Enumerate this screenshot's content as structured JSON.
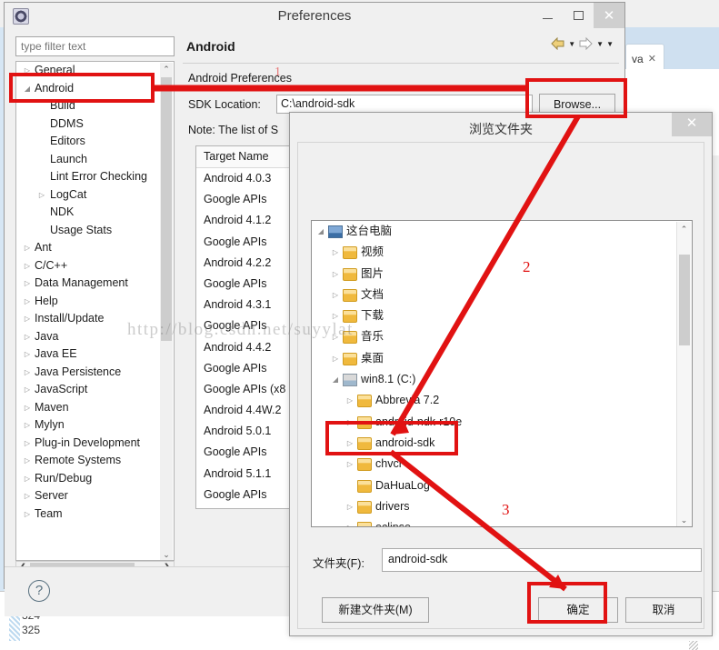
{
  "eclipse": {
    "editor_tab_label": "va",
    "editor_tab_close": "✕",
    "line_numbers": [
      "324",
      "325"
    ],
    "minimize_chevron": "⌄"
  },
  "preferences": {
    "title": "Preferences",
    "window_buttons": {
      "minimize": "",
      "maximize": "",
      "close": "✕"
    },
    "filter": {
      "placeholder": "type filter text",
      "value": ""
    },
    "tree": [
      {
        "label": "General",
        "depth": 0,
        "arrow": "▷"
      },
      {
        "label": "Android",
        "depth": 0,
        "arrow": "◢"
      },
      {
        "label": "Build",
        "depth": 1,
        "arrow": ""
      },
      {
        "label": "DDMS",
        "depth": 1,
        "arrow": ""
      },
      {
        "label": "Editors",
        "depth": 1,
        "arrow": ""
      },
      {
        "label": "Launch",
        "depth": 1,
        "arrow": ""
      },
      {
        "label": "Lint Error Checking",
        "depth": 1,
        "arrow": ""
      },
      {
        "label": "LogCat",
        "depth": 1,
        "arrow": "▷"
      },
      {
        "label": "NDK",
        "depth": 1,
        "arrow": ""
      },
      {
        "label": "Usage Stats",
        "depth": 1,
        "arrow": ""
      },
      {
        "label": "Ant",
        "depth": 0,
        "arrow": "▷"
      },
      {
        "label": "C/C++",
        "depth": 0,
        "arrow": "▷"
      },
      {
        "label": "Data Management",
        "depth": 0,
        "arrow": "▷"
      },
      {
        "label": "Help",
        "depth": 0,
        "arrow": "▷"
      },
      {
        "label": "Install/Update",
        "depth": 0,
        "arrow": "▷"
      },
      {
        "label": "Java",
        "depth": 0,
        "arrow": "▷"
      },
      {
        "label": "Java EE",
        "depth": 0,
        "arrow": "▷"
      },
      {
        "label": "Java Persistence",
        "depth": 0,
        "arrow": "▷"
      },
      {
        "label": "JavaScript",
        "depth": 0,
        "arrow": "▷"
      },
      {
        "label": "Maven",
        "depth": 0,
        "arrow": "▷"
      },
      {
        "label": "Mylyn",
        "depth": 0,
        "arrow": "▷"
      },
      {
        "label": "Plug-in Development",
        "depth": 0,
        "arrow": "▷"
      },
      {
        "label": "Remote Systems",
        "depth": 0,
        "arrow": "▷"
      },
      {
        "label": "Run/Debug",
        "depth": 0,
        "arrow": "▷"
      },
      {
        "label": "Server",
        "depth": 0,
        "arrow": "▷"
      },
      {
        "label": "Team",
        "depth": 0,
        "arrow": "▷"
      }
    ],
    "tree_scroll": {
      "up": "⌃",
      "down": "⌄",
      "left": "❮",
      "right": "❯"
    },
    "content": {
      "heading": "Android",
      "subtitle": "Android Preferences",
      "sdk_location_label": "SDK Location:",
      "sdk_location_value": "C:\\android-sdk",
      "browse_label": "Browse...",
      "note": "Note: The list of S",
      "nav": {
        "back": "back-arrow",
        "back_menu": "▼",
        "forward": "forward-arrow",
        "forward_menu": "▼",
        "view_menu": "▼"
      }
    },
    "targets": {
      "columns": [
        "Target Name"
      ],
      "rows": [
        [
          "Android 4.0.3"
        ],
        [
          "Google APIs"
        ],
        [
          "Android 4.1.2"
        ],
        [
          "Google APIs"
        ],
        [
          "Android 4.2.2"
        ],
        [
          "Google APIs"
        ],
        [
          "Android 4.3.1"
        ],
        [
          "Google APIs"
        ],
        [
          "Android 4.4.2"
        ],
        [
          "Google APIs"
        ],
        [
          "Google APIs (x8"
        ],
        [
          "Android 4.4W.2"
        ],
        [
          "Android 5.0.1"
        ],
        [
          "Google APIs"
        ],
        [
          "Android 5.1.1"
        ],
        [
          "Google APIs"
        ]
      ]
    },
    "footer": {
      "help_icon": "?"
    }
  },
  "browse_dialog": {
    "title": "浏览文件夹",
    "close": "✕",
    "tree": [
      {
        "label": "这台电脑",
        "depth": 0,
        "arrow": "◢",
        "icon": "computer-icon"
      },
      {
        "label": "视频",
        "depth": 1,
        "arrow": "▷",
        "icon": "folder-icon"
      },
      {
        "label": "图片",
        "depth": 1,
        "arrow": "▷",
        "icon": "folder-icon"
      },
      {
        "label": "文档",
        "depth": 1,
        "arrow": "▷",
        "icon": "folder-icon"
      },
      {
        "label": "下载",
        "depth": 1,
        "arrow": "▷",
        "icon": "folder-icon"
      },
      {
        "label": "音乐",
        "depth": 1,
        "arrow": "▷",
        "icon": "folder-icon"
      },
      {
        "label": "桌面",
        "depth": 1,
        "arrow": "▷",
        "icon": "folder-icon"
      },
      {
        "label": "win8.1 (C:)",
        "depth": 1,
        "arrow": "◢",
        "icon": "drive-icon"
      },
      {
        "label": "Abbrevia 7.2",
        "depth": 2,
        "arrow": "▷",
        "icon": "folder-icon"
      },
      {
        "label": "android-ndk-r10e",
        "depth": 2,
        "arrow": "▷",
        "icon": "folder-icon"
      },
      {
        "label": "android-sdk",
        "depth": 2,
        "arrow": "▷",
        "icon": "folder-icon"
      },
      {
        "label": "chvcr",
        "depth": 2,
        "arrow": "▷",
        "icon": "folder-icon"
      },
      {
        "label": "DaHuaLog",
        "depth": 2,
        "arrow": "",
        "icon": "folder-icon"
      },
      {
        "label": "drivers",
        "depth": 2,
        "arrow": "▷",
        "icon": "folder-icon"
      },
      {
        "label": "eclipse",
        "depth": 2,
        "arrow": "▷",
        "icon": "folder-icon"
      }
    ],
    "scroll": {
      "up": "⌃",
      "down": "⌄"
    },
    "folder_label": "文件夹(F):",
    "folder_value": "android-sdk",
    "buttons": {
      "new_folder": "新建文件夹(M)",
      "ok": "确定",
      "cancel": "取消"
    }
  },
  "annotations": {
    "numbers": [
      "1",
      "2",
      "3"
    ],
    "highlight_color": "#e11212",
    "watermark": "http://blog.csdn.net/suyylat"
  }
}
